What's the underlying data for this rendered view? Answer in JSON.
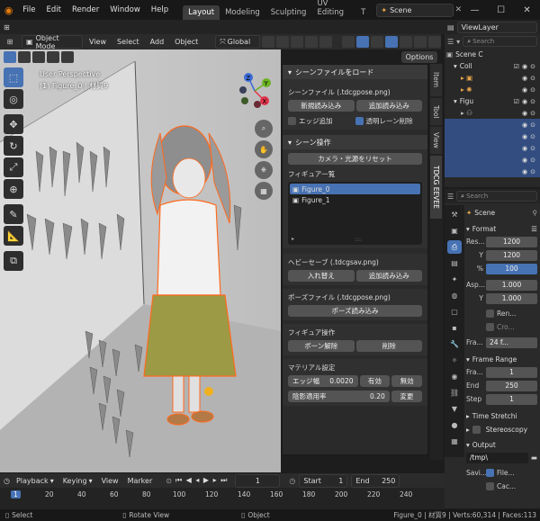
{
  "app": {
    "menus": [
      "File",
      "Edit",
      "Render",
      "Window",
      "Help"
    ],
    "workspaces": [
      "Layout",
      "Modeling",
      "Sculpting",
      "UV Editing",
      "T"
    ],
    "active_workspace": "Layout",
    "scene": "Scene",
    "view_layer": "ViewLayer"
  },
  "header3d": {
    "mode": "Object Mode",
    "menus": [
      "View",
      "Select",
      "Add",
      "Object"
    ],
    "transform": "Global",
    "options": "Options"
  },
  "viewport": {
    "title": "User Perspective",
    "subtitle": "(1) Figure_0 | 材質9",
    "gizmo": {
      "z": "Z",
      "y": "Y",
      "x": "X"
    }
  },
  "npanel": {
    "load": {
      "title": "シーンファイルをロード",
      "file_label": "シーンファイル (.tdcgpose.png)",
      "new_load": "新規読み込み",
      "add_load": "追加読み込み",
      "edge": "エッジ追加",
      "transparent": "透明レーン削除"
    },
    "scene_ops": {
      "title": "シーン操作",
      "reset": "カメラ・光源をリセット",
      "figure_list": "フィギュア一覧",
      "figures": [
        "Figure_0",
        "Figure_1"
      ]
    },
    "heavy": {
      "title": "ヘビーセーブ (.tdcgsav.png)",
      "replace": "入れ替え",
      "add": "追加読み込み"
    },
    "pose": {
      "title": "ポーズファイル (.tdcgpose.png)",
      "load": "ポーズ読み込み"
    },
    "figure_ops": {
      "title": "フィギュア操作",
      "unbone": "ボーン解除",
      "delete": "削除"
    },
    "material": {
      "title": "マテリアル設定",
      "edge_label": "エッジ幅",
      "edge_value": "0.0020",
      "enable": "有効",
      "disable": "無効",
      "shade_label": "陰影適用率",
      "shade_value": "0.20",
      "change": "変更"
    }
  },
  "sidetabs": [
    "Item",
    "Tool",
    "View",
    "TDCG EEVEE"
  ],
  "outliner": {
    "search": "Search",
    "rows": [
      "Scene C",
      "Coll",
      "",
      "",
      "Figu",
      "",
      "",
      "",
      "",
      "",
      "",
      ""
    ]
  },
  "properties": {
    "search": "Search",
    "scene": "Scene",
    "format_title": "Format",
    "res_x_label": "Res...",
    "res_x": "1200",
    "res_y_label": "Y",
    "res_y": "1200",
    "pct_label": "%",
    "pct": "100",
    "asp_x_label": "Asp...",
    "asp_x": "1.000",
    "asp_y_label": "Y",
    "asp_y": "1.000",
    "ren_label": "Ren...",
    "cro_label": "Cro...",
    "fra_label": "Fra...",
    "fps": "24 f...",
    "frame_range_title": "Frame Range",
    "start_label": "Fra...",
    "start": "1",
    "end_label": "End",
    "end": "250",
    "step_label": "Step",
    "step": "1",
    "time_stretch": "Time Stretchi",
    "stereoscopy": "Stereoscopy",
    "output_title": "Output",
    "path": "/tmp\\",
    "saving_label": "Savi...",
    "file_ext": "File...",
    "cache": "Cac..."
  },
  "timeline": {
    "menus": [
      "Playback",
      "Keying",
      "View",
      "Marker"
    ],
    "current": "1",
    "start_label": "Start",
    "start": "1",
    "end_label": "End",
    "end": "250",
    "ticks": [
      "1",
      "20",
      "40",
      "60",
      "80",
      "100",
      "120",
      "140",
      "160",
      "180",
      "200",
      "220",
      "240"
    ]
  },
  "status": {
    "select": "Select",
    "rotate": "Rotate View",
    "object": "Object",
    "info": "Figure_0 | 材質9 | Verts:60,314 | Faces:113"
  }
}
